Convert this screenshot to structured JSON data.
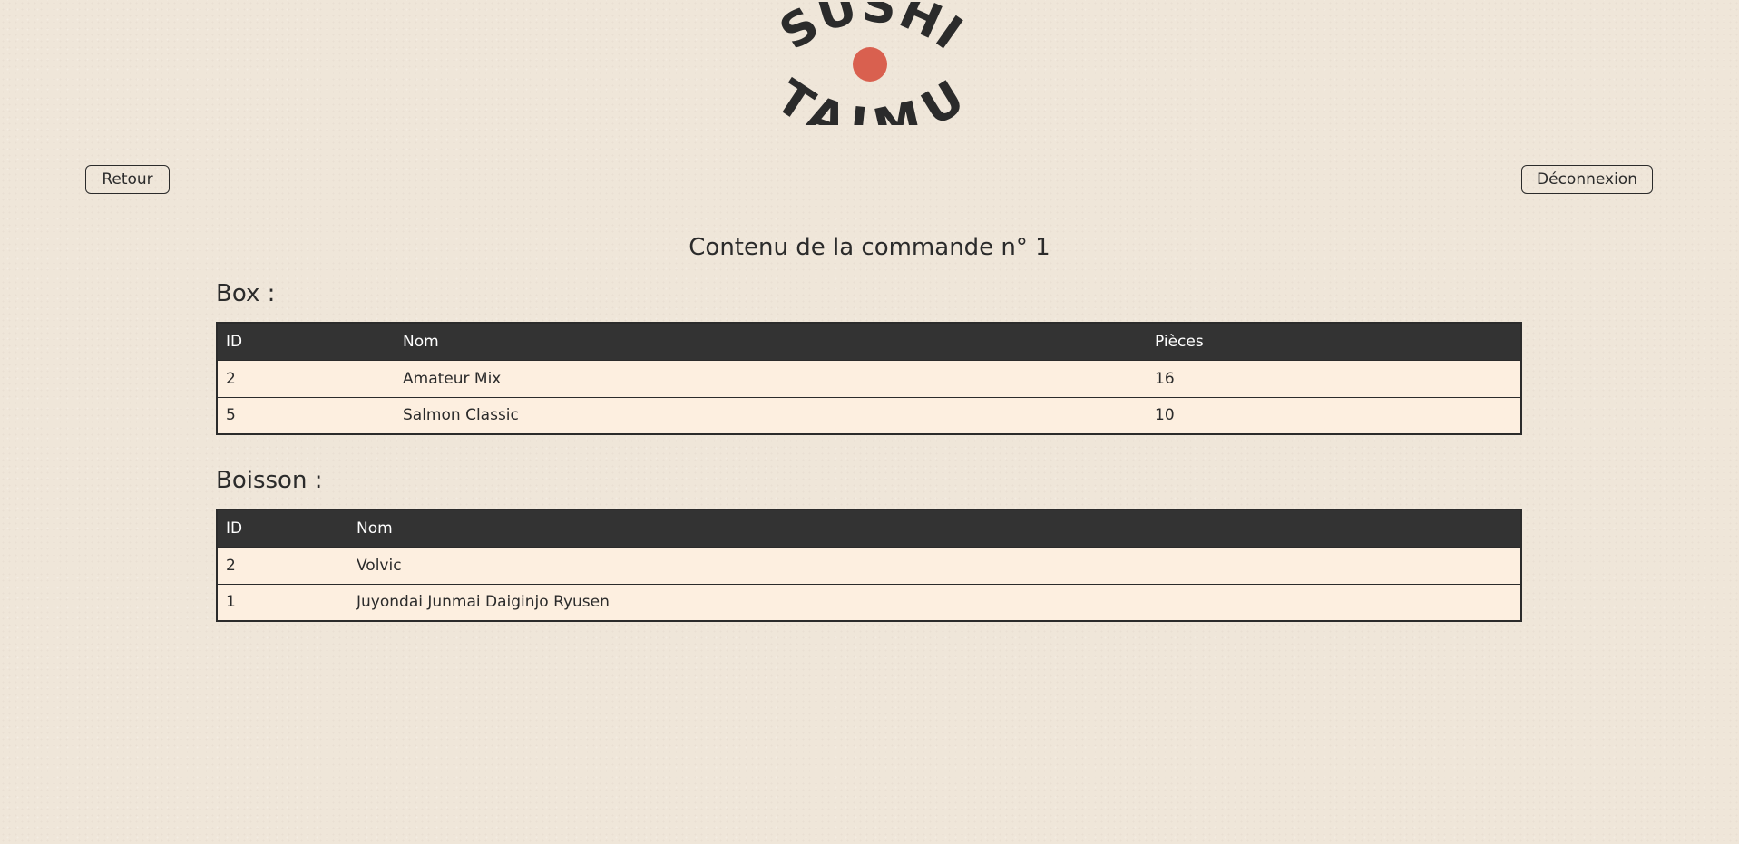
{
  "brand": {
    "logo_line1": "SUSHI",
    "logo_line2": "TAIMU",
    "accent_color": "#d9604f"
  },
  "nav": {
    "back_label": "Retour",
    "logout_label": "Déconnexion"
  },
  "page": {
    "title": "Contenu de la commande n° 1"
  },
  "box_section": {
    "heading": "Box :",
    "columns": [
      "ID",
      "Nom",
      "Pièces"
    ],
    "rows": [
      [
        "2",
        "Amateur Mix",
        "16"
      ],
      [
        "5",
        "Salmon Classic",
        "10"
      ]
    ]
  },
  "drink_section": {
    "heading": "Boisson :",
    "columns": [
      "ID",
      "Nom"
    ],
    "rows": [
      [
        "2",
        "Volvic"
      ],
      [
        "1",
        "Juyondai Junmai Daiginjo Ryusen"
      ]
    ]
  }
}
